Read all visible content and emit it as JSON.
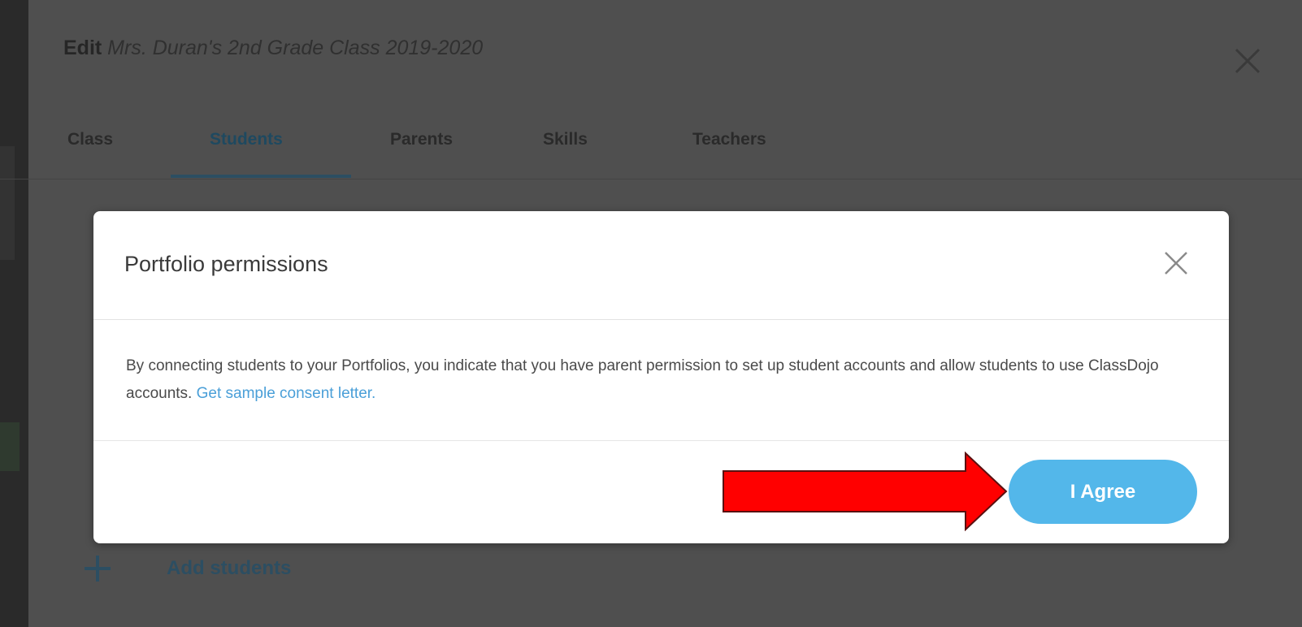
{
  "edit_panel": {
    "edit_label": "Edit",
    "class_name": "Mrs. Duran's 2nd Grade Class 2019-2020",
    "close_icon": "close-icon",
    "tabs": [
      {
        "label": "Class",
        "active": false
      },
      {
        "label": "Students",
        "active": true
      },
      {
        "label": "Parents",
        "active": false
      },
      {
        "label": "Skills",
        "active": false
      },
      {
        "label": "Teachers",
        "active": false
      }
    ],
    "add_students_label": "Add students",
    "add_icon": "plus-icon"
  },
  "modal": {
    "title": "Portfolio permissions",
    "close_icon": "close-icon",
    "body_text": "By connecting students to your Portfolios, you indicate that you have parent permission to set up student accounts and allow students to use ClassDojo accounts.",
    "link_text": "Get sample consent letter.",
    "agree_label": "I Agree"
  },
  "annotation": {
    "arrow_icon": "red-arrow-right-icon"
  },
  "colors": {
    "overlay": "#4f4f4f",
    "accent": "#53b7ea",
    "link": "#4a9fd8",
    "arrow": "#ff0000"
  }
}
